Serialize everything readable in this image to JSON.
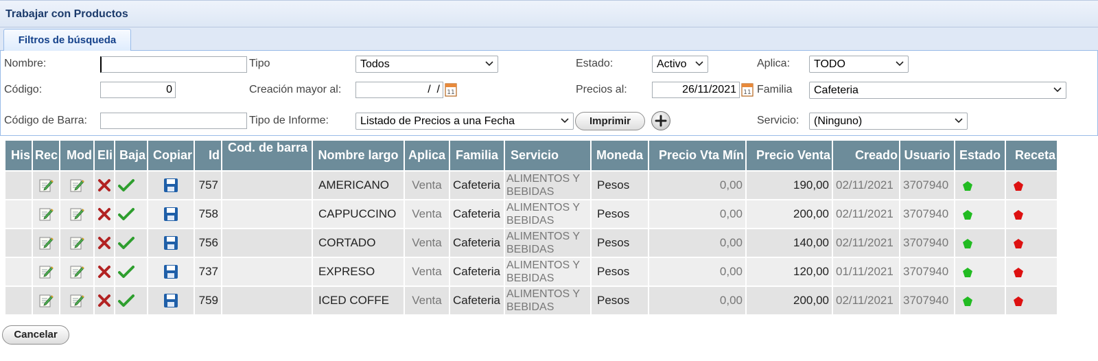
{
  "window": {
    "title": "Trabajar con Productos"
  },
  "tabs": [
    {
      "label": "Filtros de búsqueda",
      "active": true
    }
  ],
  "filters": {
    "nombre": {
      "label": "Nombre:",
      "value": ""
    },
    "tipo": {
      "label": "Tipo",
      "value": "Todos"
    },
    "estado": {
      "label": "Estado:",
      "value": "Activo"
    },
    "aplica": {
      "label": "Aplica:",
      "value": "TODO"
    },
    "codigo": {
      "label": "Código:",
      "value": "0"
    },
    "creacion": {
      "label": "Creación mayor al:",
      "value": "  /  /"
    },
    "precios": {
      "label": "Precios al:",
      "value": "26/11/2021"
    },
    "familia": {
      "label": "Familia",
      "value": "Cafeteria"
    },
    "codigo_barra": {
      "label": "Código de Barra:",
      "value": ""
    },
    "tipo_informe": {
      "label": "Tipo de Informe:",
      "value": "Listado de Precios a una Fecha"
    },
    "servicio": {
      "label": "Servicio:",
      "value": "(Ninguno)"
    }
  },
  "actions": {
    "print_label": "Imprimir",
    "cancel_label": "Cancelar"
  },
  "table": {
    "columns": [
      "His",
      "Rec",
      "Mod",
      "Eli",
      "Baja",
      "Copiar",
      "Id",
      "Cod. de barra",
      "Nombre largo",
      "Aplica",
      "Familia",
      "Servicio",
      "Moneda",
      "Precio Vta Mín",
      "Precio Venta",
      "Creado",
      "Usuario",
      "Estado",
      "Receta"
    ],
    "rows": [
      {
        "id": "757",
        "barcode": "",
        "nombre": "AMERICANO",
        "aplica": "Venta",
        "familia": "Cafeteria",
        "servicio": "ALIMENTOS Y BEBIDAS",
        "moneda": "Pesos",
        "precio_min": "0,00",
        "precio_venta": "190,00",
        "creado": "02/11/2021",
        "usuario": "3707940"
      },
      {
        "id": "758",
        "barcode": "",
        "nombre": "CAPPUCCINO",
        "aplica": "Venta",
        "familia": "Cafeteria",
        "servicio": "ALIMENTOS Y BEBIDAS",
        "moneda": "Pesos",
        "precio_min": "0,00",
        "precio_venta": "200,00",
        "creado": "02/11/2021",
        "usuario": "3707940"
      },
      {
        "id": "756",
        "barcode": "",
        "nombre": "CORTADO",
        "aplica": "Venta",
        "familia": "Cafeteria",
        "servicio": "ALIMENTOS Y BEBIDAS",
        "moneda": "Pesos",
        "precio_min": "0,00",
        "precio_venta": "140,00",
        "creado": "02/11/2021",
        "usuario": "3707940"
      },
      {
        "id": "737",
        "barcode": "",
        "nombre": "EXPRESO",
        "aplica": "Venta",
        "familia": "Cafeteria",
        "servicio": "ALIMENTOS Y BEBIDAS",
        "moneda": "Pesos",
        "precio_min": "0,00",
        "precio_venta": "120,00",
        "creado": "01/11/2021",
        "usuario": "3707940"
      },
      {
        "id": "759",
        "barcode": "",
        "nombre": "ICED COFFE",
        "aplica": "Venta",
        "familia": "Cafeteria",
        "servicio": "ALIMENTOS Y BEBIDAS",
        "moneda": "Pesos",
        "precio_min": "0,00",
        "precio_venta": "200,00",
        "creado": "02/11/2021",
        "usuario": "3707940"
      }
    ]
  },
  "colors": {
    "header_bg": "#6d8c9a",
    "status_active": "#22bb22",
    "recipe_red": "#dd1111",
    "delete_red": "#b22222",
    "check_green": "#2e9e2e",
    "save_blue": "#1f5fa8"
  }
}
